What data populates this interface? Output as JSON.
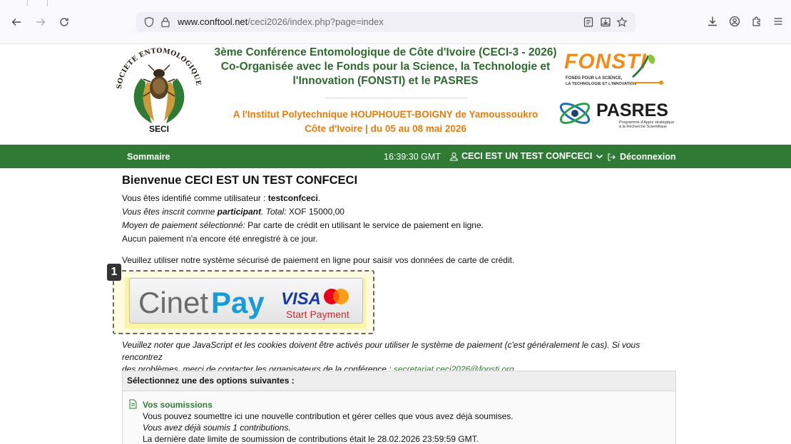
{
  "browser": {
    "url_host": "www.conftool.net",
    "url_path": "/ceci2026/index.php?page=index"
  },
  "header": {
    "title_line1": "3ème Conférence Entomologique de Côte d'Ivoire (CECI-3 - 2026)",
    "title_line2": "Co-Organisée avec le Fonds pour la Science, la Technologie et",
    "title_line3": "l'Innovation (FONSTI) et le PASRES",
    "sub_line1": "A l'Institut Polytechnique HOUPHOUET-BOIGNY de Yamoussoukro",
    "sub_line2": "Côte d'Ivoire | du 05 au 08 mai 2026",
    "seci_ring": "SOCIETE ENTOMOLOGIQUE DE CÔTE D'IVOIRE",
    "seci_abbr": "SECI",
    "fonsti_name": "FONSTI",
    "fonsti_tagline1": "FONDS POUR LA SCIENCE,",
    "fonsti_tagline2": "LA TECHNOLOGIE ET L'INNOVATION",
    "pasres_name": "PASRES",
    "pasres_tagline1": "Programme d'Appui stratégique",
    "pasres_tagline2": "à la Recherche Scientifique"
  },
  "nav": {
    "summary": "Sommaire",
    "time": "16:39:30 GMT",
    "user": "CECI EST UN TEST CONFCECI",
    "logout": "Déconnexion"
  },
  "main": {
    "welcome": "Bienvenue CECI EST UN TEST CONFCECI",
    "identified_prefix": "Vous êtes identifié comme utilisateur : ",
    "username": "testconfceci",
    "registered_prefix": "Vous êtes inscrit comme ",
    "role": "participant",
    "total_label": ". Total:",
    "total_value": " XOF 15000,00",
    "payment_label": "Moyen de paiement sélectionné:",
    "payment_value": " Par carte de crédit en utilisant le service de paiement en ligne.",
    "no_payment": "Aucun paiement n'a encore été enregistré à ce jour.",
    "use_secure": "Veuillez utiliser notre système sécurisé de paiement en ligne pour saisir vos données de carte de crédit.",
    "badge": "1",
    "pay_brand_a": "Cinet",
    "pay_brand_b": "Pay",
    "pay_visa": "VISA",
    "pay_start": "Start Payment",
    "note_line1": "Veuillez noter que JavaScript et les cookies doivent être activés pour utiliser le système de paiement (c'est généralement le cas). Si vous rencontrez",
    "note_line2_prefix": "des problèmes, merci de contacter les organisateurs de la conférence : ",
    "contact_email": "secretariat.ceci2026@fonsti.org",
    "note_line2_suffix": "."
  },
  "options": {
    "heading": "Sélectionnez une des options suivantes :",
    "submissions_title": "Vos soumissions",
    "submissions_desc": "Vous pouvez soumettre ici une nouvelle contribution et gérer celles que vous avez déjà soumises.",
    "submissions_count": "Vous avez déjà soumis 1 contributions.",
    "deadline": "La dernière date limite de soumission de contributions était le 28.02.2026 23:59:59 GMT."
  },
  "colors": {
    "nav_green": "#2f7a35",
    "title_green": "#2d6a2d",
    "subtitle_orange": "#e07d10",
    "highlight_yellow": "#fbf5a3"
  }
}
